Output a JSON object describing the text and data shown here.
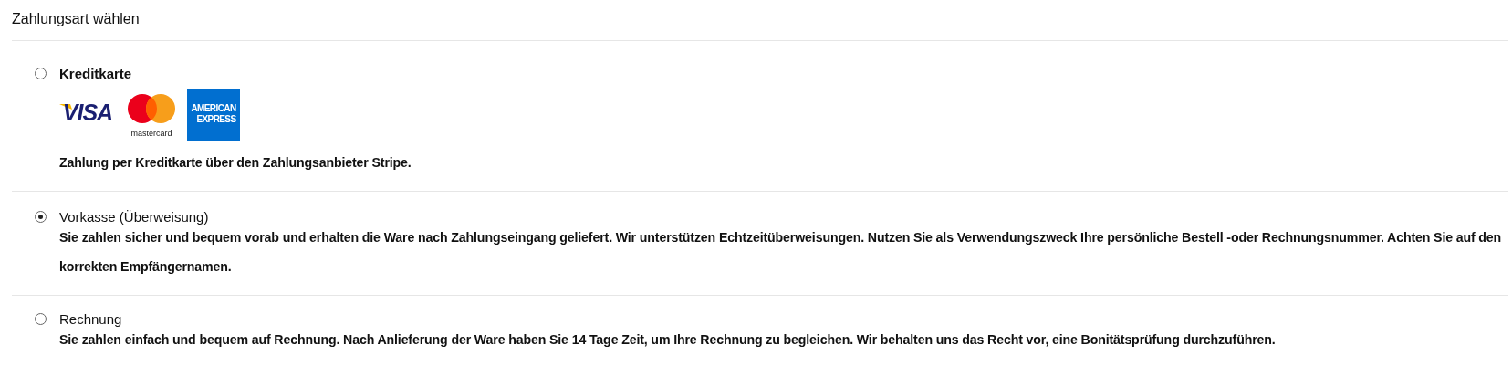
{
  "heading": "Zahlungsart wählen",
  "options": [
    {
      "label": "Kreditkarte",
      "selected": false,
      "card_logos": [
        {
          "kind": "visa",
          "lines": [
            "VISA"
          ]
        },
        {
          "kind": "mastercard",
          "lines": [
            "mastercard"
          ]
        },
        {
          "kind": "amex",
          "lines": [
            "AMERICAN",
            "EXPRESS"
          ]
        }
      ],
      "description": "Zahlung per Kreditkarte über den Zahlungsanbieter Stripe."
    },
    {
      "label": "Vorkasse (Überweisung)",
      "selected": true,
      "description": "Sie zahlen sicher und bequem vorab und erhalten die Ware nach Zahlungseingang geliefert. Wir unterstützen Echtzeitüberweisungen. Nutzen Sie als Verwendungszweck Ihre persönliche Bestell -oder Rechnungsnummer. Achten Sie auf den korrekten Empfängernamen."
    },
    {
      "label": "Rechnung",
      "selected": false,
      "description": "Sie zahlen einfach und bequem auf Rechnung. Nach Anlieferung der Ware haben Sie 14 Tage Zeit, um Ihre Rechnung zu begleichen. Wir behalten uns das Recht vor, eine Bonitätsprüfung durchzuführen."
    }
  ]
}
